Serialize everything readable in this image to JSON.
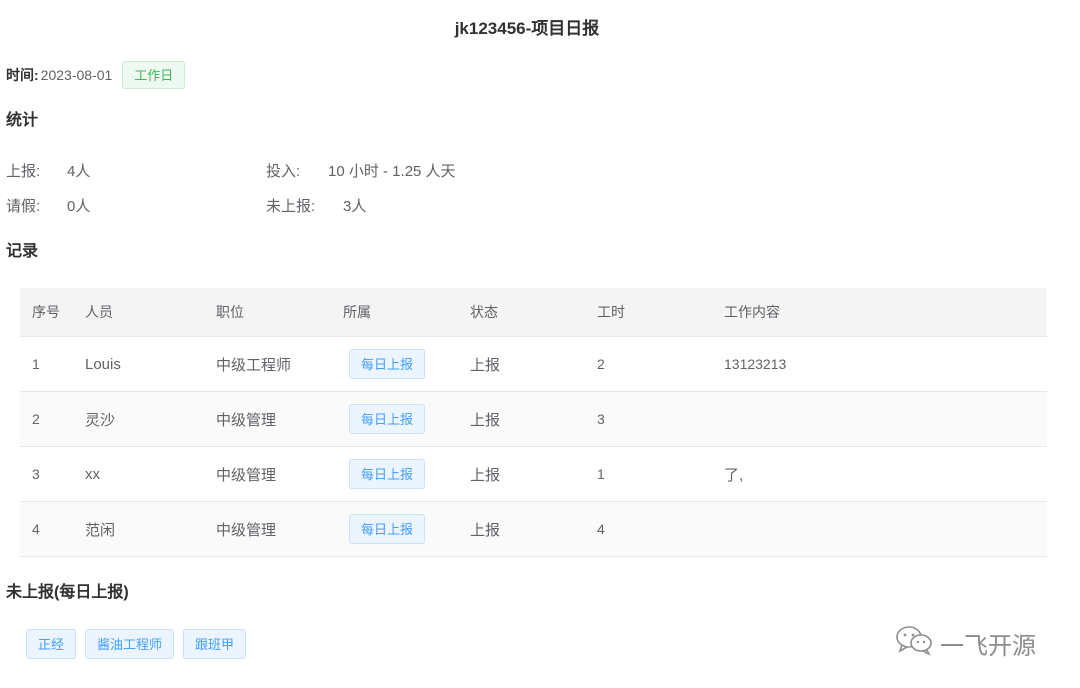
{
  "header": {
    "title": "jk123456-项目日报"
  },
  "date": {
    "label": "时间:",
    "value": "2023-08-01",
    "tag": "工作日"
  },
  "stats": {
    "title": "统计",
    "reported": {
      "label": "上报:",
      "value": "4人"
    },
    "leave": {
      "label": "请假:",
      "value": "0人"
    },
    "input": {
      "label": "投入:",
      "value": "10 小时 - 1.25 人天"
    },
    "unreported": {
      "label": "未上报:",
      "value": "3人"
    }
  },
  "records": {
    "title": "记录",
    "columns": [
      "序号",
      "人员",
      "职位",
      "所属",
      "状态",
      "工时",
      "工作内容"
    ],
    "rows": [
      {
        "no": "1",
        "name": "Louis",
        "position": "中级工程师",
        "group": "每日上报",
        "status": "上报",
        "hours": "2",
        "content": "13123213"
      },
      {
        "no": "2",
        "name": "灵沙",
        "position": "中级管理",
        "group": "每日上报",
        "status": "上报",
        "hours": "3",
        "content": ""
      },
      {
        "no": "3",
        "name": "xx",
        "position": "中级管理",
        "group": "每日上报",
        "status": "上报",
        "hours": "1",
        "content": "了,"
      },
      {
        "no": "4",
        "name": "范闲",
        "position": "中级管理",
        "group": "每日上报",
        "status": "上报",
        "hours": "4",
        "content": ""
      }
    ]
  },
  "unreported_section": {
    "title": "未上报(每日上报)",
    "people": [
      "正经",
      "酱油工程师",
      "跟班甲"
    ]
  },
  "watermark": {
    "text": "一飞开源",
    "icon": "wechat-icon"
  },
  "colors": {
    "tag_green": "#3fb75b",
    "tag_blue": "#409eff",
    "header_bg": "#f4f4f5"
  }
}
